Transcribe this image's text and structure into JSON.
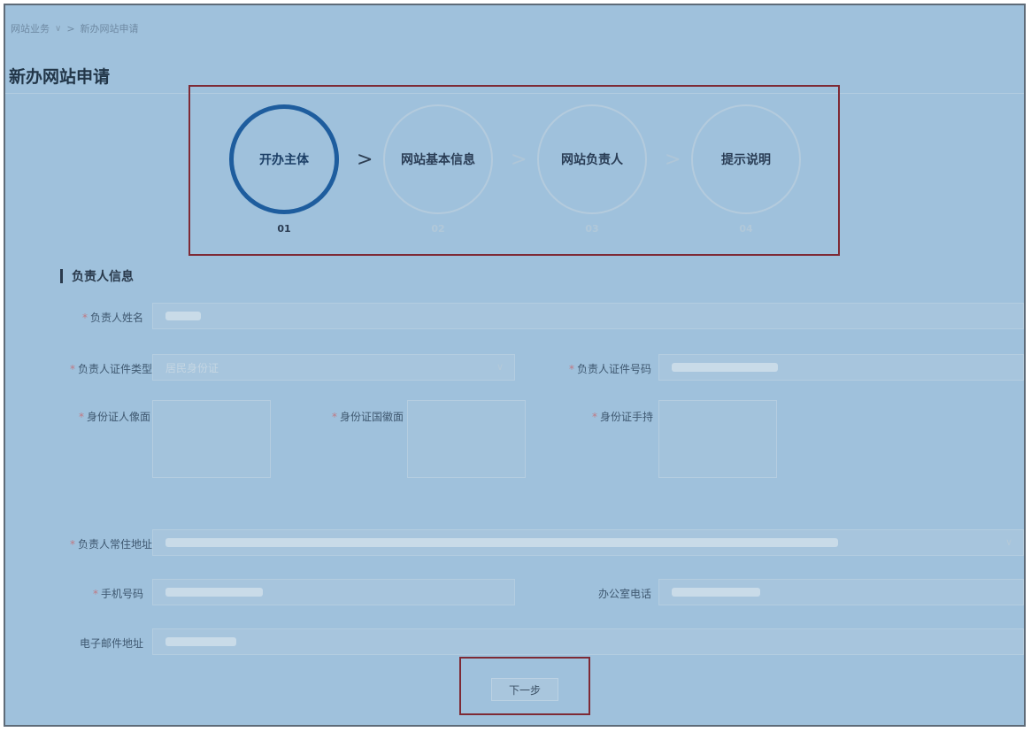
{
  "breadcrumb": {
    "parent": "网站业务",
    "separator": ">",
    "current": "新办网站申请"
  },
  "page_title": "新办网站申请",
  "steps": [
    {
      "label": "开办主体",
      "number": "01",
      "active": true
    },
    {
      "label": "网站基本信息",
      "number": "02",
      "active": false
    },
    {
      "label": "网站负责人",
      "number": "03",
      "active": false
    },
    {
      "label": "提示说明",
      "number": "04",
      "active": false
    }
  ],
  "section_title": "负责人信息",
  "form": {
    "name_label": "负责人姓名",
    "id_type_label": "负责人证件类型",
    "id_type_value": "居民身份证",
    "id_number_label": "负责人证件号码",
    "id_front_label": "身份证人像面",
    "id_back_label": "身份证国徽面",
    "id_hold_label": "身份证手持",
    "address_label": "负责人常住地址",
    "mobile_label": "手机号码",
    "office_phone_label": "办公室电话",
    "email_label": "电子邮件地址"
  },
  "next_button": "下一步",
  "colors": {
    "active_step": "#1e5d9e",
    "highlight_box": "#7e2a35",
    "background": "#9fc1dc"
  }
}
